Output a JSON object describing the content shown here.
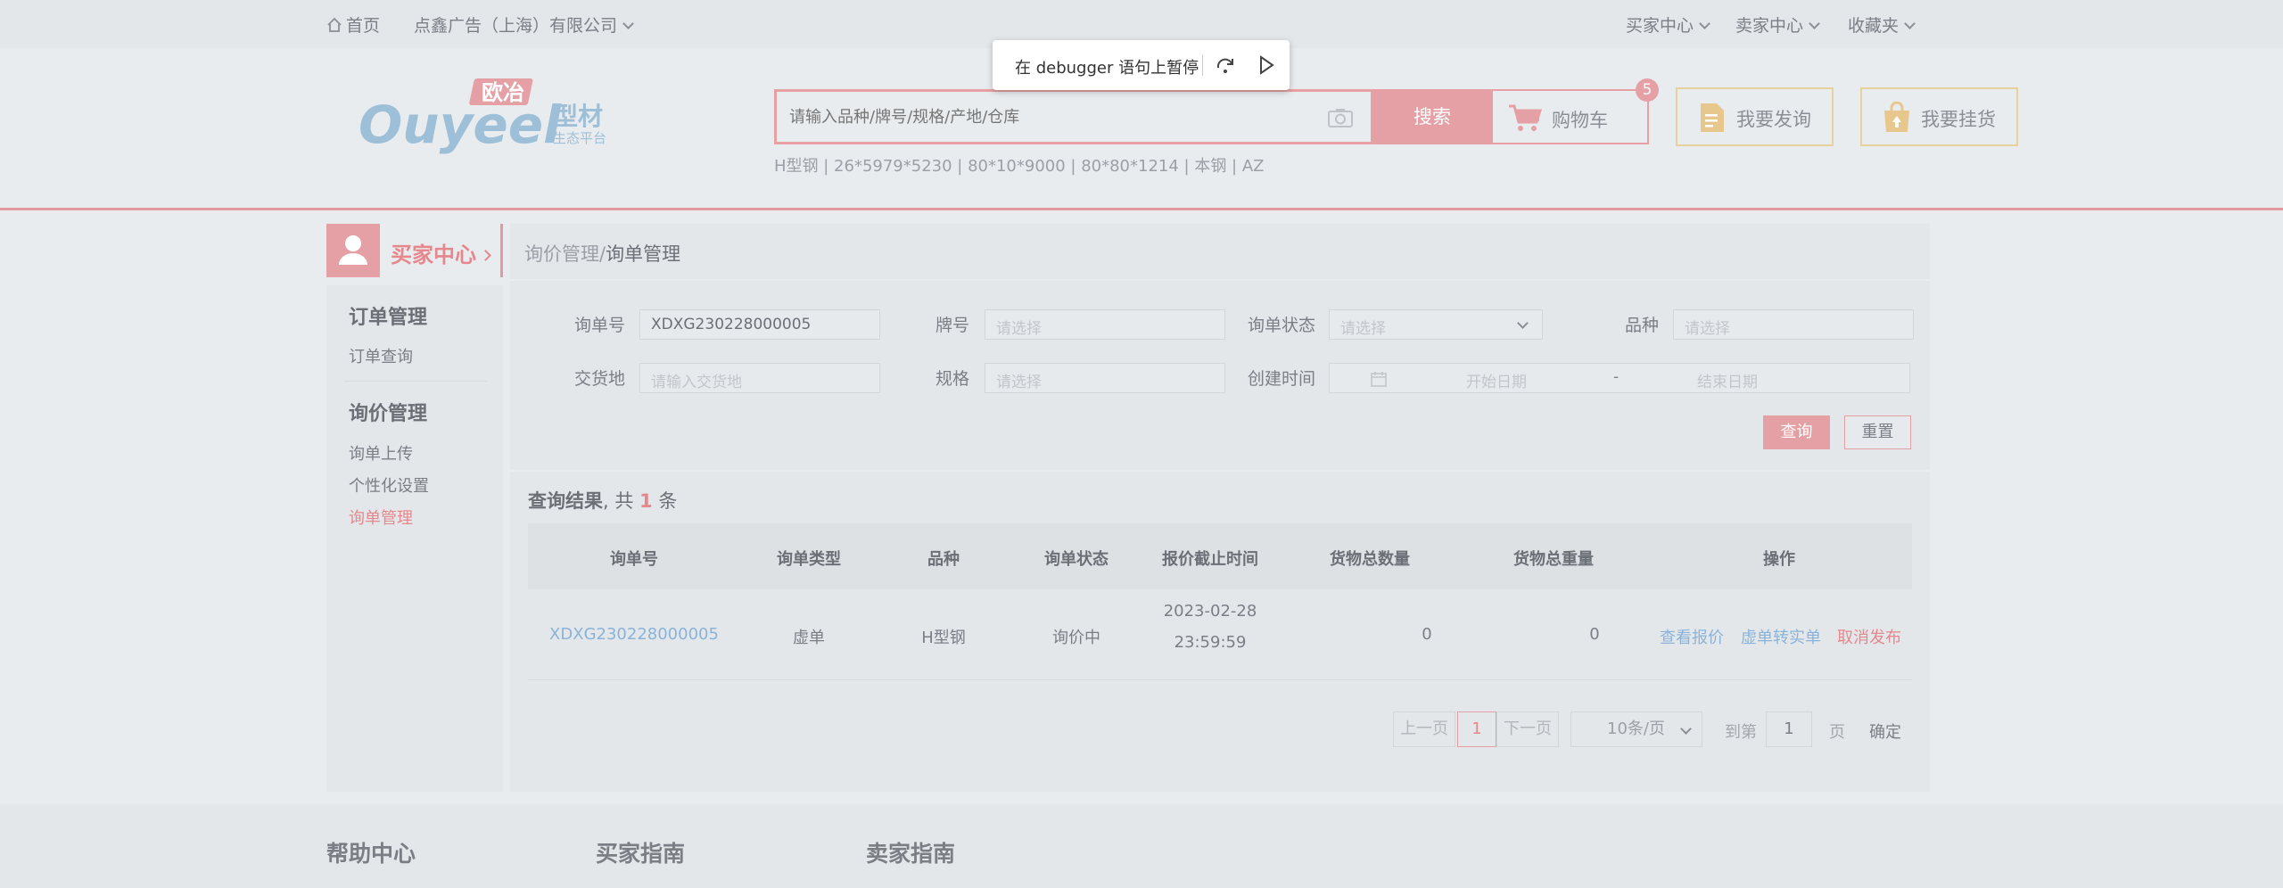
{
  "topbar": {
    "home": "首页",
    "company": "点鑫广告（上海）有限公司",
    "buyer_center": "买家中心",
    "seller_center": "卖家中心",
    "favorites": "收藏夹"
  },
  "logo": {
    "brand": "Ouyeel",
    "cn": "欧冶",
    "sub": "型材",
    "sub2": "生态平台"
  },
  "search": {
    "placeholder": "请输入品种/牌号/规格/产地/仓库",
    "button": "搜索",
    "hot": "H型钢 | 26*5979*5230 | 80*10*9000 | 80*80*1214 | 本钢 | AZ"
  },
  "cart": {
    "label": "购物车",
    "count": "5"
  },
  "actions": {
    "inquiry": "我要发询",
    "listing": "我要挂货"
  },
  "debugger": {
    "text": "在 debugger 语句上暂停"
  },
  "sidebar": {
    "title": "买家中心",
    "groups": [
      {
        "label": "订单管理",
        "items": [
          "订单查询"
        ]
      },
      {
        "label": "询价管理",
        "items": [
          "询单上传",
          "个性化设置",
          "询单管理"
        ]
      }
    ]
  },
  "breadcrumb": {
    "parent": "询价管理",
    "sep": "/",
    "current": "询单管理"
  },
  "filters": {
    "inquiry_no_label": "询单号",
    "inquiry_no_value": "XDXG230228000005",
    "brand_label": "牌号",
    "brand_placeholder": "请选择",
    "status_label": "询单状态",
    "status_placeholder": "请选择",
    "variety_label": "品种",
    "variety_placeholder": "请选择",
    "delivery_label": "交货地",
    "delivery_placeholder": "请输入交货地",
    "spec_label": "规格",
    "spec_placeholder": "请选择",
    "created_label": "创建时间",
    "start_placeholder": "开始日期",
    "range_sep": "-",
    "end_placeholder": "结束日期",
    "query": "查询",
    "reset": "重置"
  },
  "results": {
    "prefix": "查询结果",
    "middle": ", 共",
    "count": "1",
    "suffix": "条",
    "columns": [
      "询单号",
      "询单类型",
      "品种",
      "询单状态",
      "报价截止时间",
      "货物总数量",
      "货物总重量",
      "操作"
    ],
    "rows": [
      {
        "no": "XDXG230228000005",
        "type": "虚单",
        "variety": "H型钢",
        "status": "询价中",
        "deadline_date": "2023-02-28",
        "deadline_time": "23:59:59",
        "qty": "0",
        "weight": "0",
        "ops": [
          "查看报价",
          "虚单转实单",
          "取消发布"
        ]
      }
    ]
  },
  "pagination": {
    "prev": "上一页",
    "current": "1",
    "next": "下一页",
    "page_size": "10条/页",
    "goto": "到第",
    "goto_value": "1",
    "page": "页",
    "confirm": "确定"
  },
  "footer": {
    "help": "帮助中心",
    "buyer_guide": "买家指南",
    "seller_guide": "卖家指南"
  },
  "colors": {
    "accent": "#e5a0a5",
    "link": "#8ab3d9",
    "bg": "#e9ecef"
  }
}
